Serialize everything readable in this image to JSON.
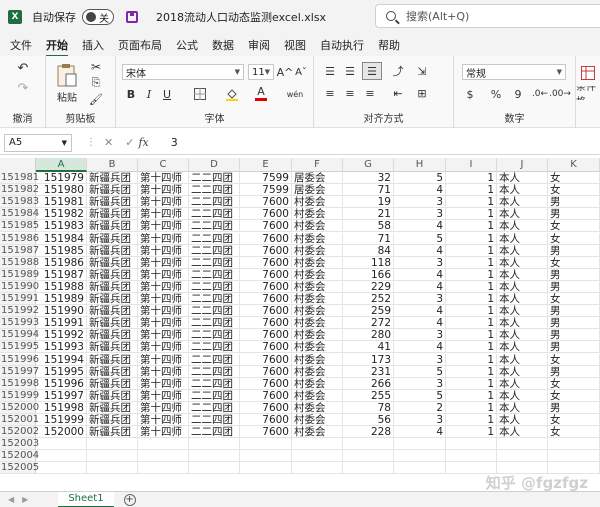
{
  "titlebar": {
    "logo": "X",
    "autosave_label": "自动保存",
    "autosave_state": "关",
    "filename": "2018流动人口动态监测excel.xlsx",
    "search_placeholder": "搜索(Alt+Q)"
  },
  "menu": [
    "文件",
    "开始",
    "插入",
    "页面布局",
    "公式",
    "数据",
    "审阅",
    "视图",
    "自动执行",
    "帮助"
  ],
  "ribbon": {
    "undo_label": "撤消",
    "paste_label": "粘贴",
    "clipboard_label": "剪贴板",
    "font_name": "宋体",
    "font_size": "11",
    "font_label": "字体",
    "align_label": "对齐方式",
    "number_format": "常规",
    "number_label": "数字",
    "conditional_label": "条件格",
    "bold": "B",
    "italic": "I",
    "underline": "U",
    "grow": "A^",
    "shrink": "Aˇ",
    "font_color": "A",
    "pinyin": "wén",
    "percent": "%",
    "comma": "9",
    "currency": "$"
  },
  "formula": {
    "namebox": "A5",
    "cancel": "✕",
    "confirm": "✓",
    "fx": "fx",
    "value": "3"
  },
  "columns": [
    "A",
    "B",
    "C",
    "D",
    "E",
    "F",
    "G",
    "H",
    "I",
    "J",
    "K"
  ],
  "rows": [
    {
      "n": "151981",
      "a": "151979",
      "b": "新疆兵团",
      "c": "第十四师",
      "d": "二二四团",
      "e": "7599",
      "f": "居委会",
      "g": "32",
      "h": "5",
      "i": "1",
      "j": "本人",
      "k": "女"
    },
    {
      "n": "151982",
      "a": "151980",
      "b": "新疆兵团",
      "c": "第十四师",
      "d": "二二四团",
      "e": "7599",
      "f": "居委会",
      "g": "71",
      "h": "4",
      "i": "1",
      "j": "本人",
      "k": "女"
    },
    {
      "n": "151983",
      "a": "151981",
      "b": "新疆兵团",
      "c": "第十四师",
      "d": "二二四团",
      "e": "7600",
      "f": "村委会",
      "g": "19",
      "h": "3",
      "i": "1",
      "j": "本人",
      "k": "男"
    },
    {
      "n": "151984",
      "a": "151982",
      "b": "新疆兵团",
      "c": "第十四师",
      "d": "二二四团",
      "e": "7600",
      "f": "村委会",
      "g": "21",
      "h": "3",
      "i": "1",
      "j": "本人",
      "k": "男"
    },
    {
      "n": "151985",
      "a": "151983",
      "b": "新疆兵团",
      "c": "第十四师",
      "d": "二二四团",
      "e": "7600",
      "f": "村委会",
      "g": "58",
      "h": "4",
      "i": "1",
      "j": "本人",
      "k": "女"
    },
    {
      "n": "151986",
      "a": "151984",
      "b": "新疆兵团",
      "c": "第十四师",
      "d": "二二四团",
      "e": "7600",
      "f": "村委会",
      "g": "71",
      "h": "5",
      "i": "1",
      "j": "本人",
      "k": "女"
    },
    {
      "n": "151987",
      "a": "151985",
      "b": "新疆兵团",
      "c": "第十四师",
      "d": "二二四团",
      "e": "7600",
      "f": "村委会",
      "g": "84",
      "h": "4",
      "i": "1",
      "j": "本人",
      "k": "男"
    },
    {
      "n": "151988",
      "a": "151986",
      "b": "新疆兵团",
      "c": "第十四师",
      "d": "二二四团",
      "e": "7600",
      "f": "村委会",
      "g": "118",
      "h": "3",
      "i": "1",
      "j": "本人",
      "k": "女"
    },
    {
      "n": "151989",
      "a": "151987",
      "b": "新疆兵团",
      "c": "第十四师",
      "d": "二二四团",
      "e": "7600",
      "f": "村委会",
      "g": "166",
      "h": "4",
      "i": "1",
      "j": "本人",
      "k": "男"
    },
    {
      "n": "151990",
      "a": "151988",
      "b": "新疆兵团",
      "c": "第十四师",
      "d": "二二四团",
      "e": "7600",
      "f": "村委会",
      "g": "229",
      "h": "4",
      "i": "1",
      "j": "本人",
      "k": "男"
    },
    {
      "n": "151991",
      "a": "151989",
      "b": "新疆兵团",
      "c": "第十四师",
      "d": "二二四团",
      "e": "7600",
      "f": "村委会",
      "g": "252",
      "h": "3",
      "i": "1",
      "j": "本人",
      "k": "女"
    },
    {
      "n": "151992",
      "a": "151990",
      "b": "新疆兵团",
      "c": "第十四师",
      "d": "二二四团",
      "e": "7600",
      "f": "村委会",
      "g": "259",
      "h": "4",
      "i": "1",
      "j": "本人",
      "k": "男"
    },
    {
      "n": "151993",
      "a": "151991",
      "b": "新疆兵团",
      "c": "第十四师",
      "d": "二二四团",
      "e": "7600",
      "f": "村委会",
      "g": "272",
      "h": "4",
      "i": "1",
      "j": "本人",
      "k": "男"
    },
    {
      "n": "151994",
      "a": "151992",
      "b": "新疆兵团",
      "c": "第十四师",
      "d": "二二四团",
      "e": "7600",
      "f": "村委会",
      "g": "280",
      "h": "3",
      "i": "1",
      "j": "本人",
      "k": "男"
    },
    {
      "n": "151995",
      "a": "151993",
      "b": "新疆兵团",
      "c": "第十四师",
      "d": "二二四团",
      "e": "7600",
      "f": "村委会",
      "g": "41",
      "h": "4",
      "i": "1",
      "j": "本人",
      "k": "男"
    },
    {
      "n": "151996",
      "a": "151994",
      "b": "新疆兵团",
      "c": "第十四师",
      "d": "二二四团",
      "e": "7600",
      "f": "村委会",
      "g": "173",
      "h": "3",
      "i": "1",
      "j": "本人",
      "k": "女"
    },
    {
      "n": "151997",
      "a": "151995",
      "b": "新疆兵团",
      "c": "第十四师",
      "d": "二二四团",
      "e": "7600",
      "f": "村委会",
      "g": "231",
      "h": "5",
      "i": "1",
      "j": "本人",
      "k": "男"
    },
    {
      "n": "151998",
      "a": "151996",
      "b": "新疆兵团",
      "c": "第十四师",
      "d": "二二四团",
      "e": "7600",
      "f": "村委会",
      "g": "266",
      "h": "3",
      "i": "1",
      "j": "本人",
      "k": "女"
    },
    {
      "n": "151999",
      "a": "151997",
      "b": "新疆兵团",
      "c": "第十四师",
      "d": "二二四团",
      "e": "7600",
      "f": "村委会",
      "g": "255",
      "h": "5",
      "i": "1",
      "j": "本人",
      "k": "女"
    },
    {
      "n": "152000",
      "a": "151998",
      "b": "新疆兵团",
      "c": "第十四师",
      "d": "二二四团",
      "e": "7600",
      "f": "村委会",
      "g": "78",
      "h": "2",
      "i": "1",
      "j": "本人",
      "k": "男"
    },
    {
      "n": "152001",
      "a": "151999",
      "b": "新疆兵团",
      "c": "第十四师",
      "d": "二二四团",
      "e": "7600",
      "f": "村委会",
      "g": "56",
      "h": "3",
      "i": "1",
      "j": "本人",
      "k": "女"
    },
    {
      "n": "152002",
      "a": "152000",
      "b": "新疆兵团",
      "c": "第十四师",
      "d": "二二四团",
      "e": "7600",
      "f": "村委会",
      "g": "228",
      "h": "4",
      "i": "1",
      "j": "本人",
      "k": "女"
    },
    {
      "n": "152003",
      "a": "",
      "b": "",
      "c": "",
      "d": "",
      "e": "",
      "f": "",
      "g": "",
      "h": "",
      "i": "",
      "j": "",
      "k": ""
    },
    {
      "n": "152004",
      "a": "",
      "b": "",
      "c": "",
      "d": "",
      "e": "",
      "f": "",
      "g": "",
      "h": "",
      "i": "",
      "j": "",
      "k": ""
    },
    {
      "n": "152005",
      "a": "",
      "b": "",
      "c": "",
      "d": "",
      "e": "",
      "f": "",
      "g": "",
      "h": "",
      "i": "",
      "j": "",
      "k": ""
    }
  ],
  "sheet_tab": "Sheet1",
  "add_sheet": "+",
  "watermark": "知乎 @fgzfgz"
}
